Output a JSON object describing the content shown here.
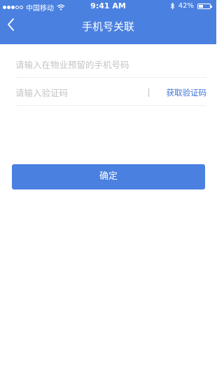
{
  "status_bar": {
    "carrier": "中国移动",
    "time": "9:41 AM",
    "battery_percent": "42%",
    "battery_level": 0.42,
    "signal_dots": [
      true,
      true,
      true,
      false,
      false
    ],
    "icons": [
      "signal-dots-icon",
      "wifi-icon",
      "bluetooth-icon",
      "battery-icon"
    ]
  },
  "nav": {
    "title": "手机号关联",
    "back_icon": "chevron-left-icon"
  },
  "form": {
    "phone_placeholder": "请输入在物业预留的手机号码",
    "phone_value": "",
    "code_placeholder": "请输入验证码",
    "code_value": "",
    "get_code_label": "获取验证码"
  },
  "confirm_label": "确定",
  "colors": {
    "primary": "#4a80e0",
    "link": "#3b73d8",
    "placeholder": "#c4c4c4",
    "divider": "#eeeeee"
  }
}
